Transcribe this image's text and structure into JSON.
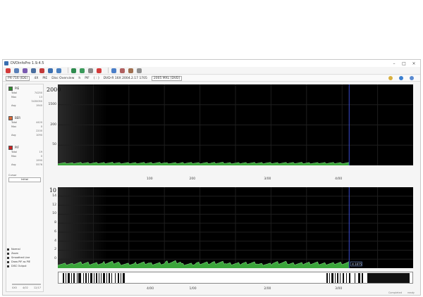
{
  "window": {
    "title": "DVDinfoPro 1.9.4.5",
    "controls": [
      "–",
      "□",
      "×"
    ]
  },
  "toolbar": {
    "icons": [
      "stop-icon",
      "wrench-icon",
      "wand-icon",
      "disc-icon",
      "eject-icon",
      "info-icon",
      "arrow-icon",
      "refresh-icon",
      "globe-icon",
      "gear-icon",
      "close-icon",
      "question-icon",
      "lock-icon",
      "flag-icon",
      "chip-icon"
    ]
  },
  "infobar": {
    "drive": "PX-716 (IDE)",
    "speed_box": "4X",
    "pi_label": "PIE",
    "mode": "Disc Overview",
    "sep": "h",
    "pif": "PIF",
    "range": "(  :  )",
    "disc_info": "DVD-R 16X 2004.2.17 1705",
    "media_id": "2005 MXL [DVD]"
  },
  "legend": [
    {
      "name": "PIE",
      "color": "#2e8b2e",
      "stats": [
        {
          "label": "Total",
          "value": "74250"
        },
        {
          "label": "Max",
          "value": "13"
        },
        {
          "label": "",
          "value": "3430050"
        },
        {
          "label": "Avg",
          "value": "1940"
        }
      ]
    },
    {
      "name": "BER",
      "color": "#d86a3a",
      "stats": [
        {
          "label": "Total",
          "value": "4420"
        },
        {
          "label": "Max",
          "value": "0"
        },
        {
          "label": "",
          "value": "2200"
        },
        {
          "label": "Avg",
          "value": "1090"
        }
      ]
    },
    {
      "name": "PIF",
      "color": "#cc2222",
      "stats": [
        {
          "label": "Total",
          "value": "19"
        },
        {
          "label": "Max",
          "value": "0"
        },
        {
          "label": "",
          "value": "1990"
        },
        {
          "label": "Avg",
          "value": "5576"
        }
      ]
    }
  ],
  "cursor": {
    "label": "Cursor",
    "value": "Initial"
  },
  "options": [
    "Normal",
    "Zoom",
    "Smoothed Line",
    "Draw PIF as PIE",
    "DISC Output"
  ],
  "sidebar_footer": {
    "left": "0X0",
    "value1": "4/02",
    "value2": "12/17"
  },
  "chart_data": [
    {
      "type": "area",
      "title": "",
      "xlabel": "",
      "ylabel": "",
      "y_ticks": [
        "2000",
        "1500",
        "200",
        "50"
      ],
      "x_ticks": [
        "100",
        "200",
        "3/00",
        "4/00"
      ],
      "ylim": [
        0,
        2000
      ],
      "series": [
        {
          "values": [
            55,
            60,
            58,
            62,
            57,
            59,
            61,
            56,
            60,
            58,
            63,
            57,
            59,
            60,
            58,
            61,
            57,
            60,
            59,
            58
          ]
        }
      ],
      "cursor_position": 0.82,
      "grid": true
    },
    {
      "type": "area",
      "title": "",
      "xlabel": "",
      "ylabel": "",
      "y_ticks": [
        "10",
        "14",
        "12",
        "10",
        "8",
        "6",
        "4",
        "2",
        "0"
      ],
      "x_ticks": [
        "1/00",
        "2/00",
        "3/00",
        "4/00"
      ],
      "ylim": [
        0,
        16
      ],
      "series": [
        {
          "values": [
            0.8,
            1.0,
            0.9,
            1.1,
            0.8,
            1.0,
            0.9,
            1.2,
            0.8,
            1.0,
            1.1,
            0.9,
            1.0,
            0.8,
            1.1,
            0.9,
            1.0,
            0.9,
            1.0,
            1.1
          ]
        }
      ],
      "cursor_position": 0.82,
      "cursor_tag": "4.1075",
      "grid": true
    }
  ],
  "status": {
    "a": "Completed",
    "b": "ready"
  }
}
